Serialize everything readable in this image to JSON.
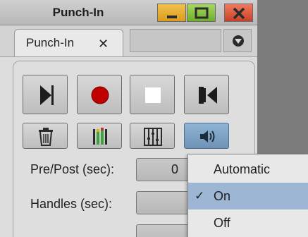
{
  "window": {
    "title": "Punch-In",
    "controls": {
      "minimize": "minimize",
      "maximize": "maximize",
      "close": "close"
    }
  },
  "tab": {
    "label": "Punch-In",
    "close_glyph": "✕"
  },
  "transport": {
    "row1": [
      {
        "name": "play-to-icon"
      },
      {
        "name": "record-icon",
        "color": "#c00000"
      },
      {
        "name": "stop-icon",
        "color": "#ffffff"
      },
      {
        "name": "go-to-punch-in-icon"
      }
    ],
    "row2": [
      {
        "name": "trash-icon"
      },
      {
        "name": "audio-meter-icon"
      },
      {
        "name": "mixer-faders-icon"
      },
      {
        "name": "speaker-icon",
        "active": true
      }
    ]
  },
  "fields": {
    "prepost_label": "Pre/Post (sec):",
    "prepost_value": "0",
    "handles_label": "Handles (sec):",
    "handles_value": ""
  },
  "menu": {
    "items": [
      {
        "label": "Automatic",
        "checked": false
      },
      {
        "label": "On",
        "checked": true
      },
      {
        "label": "Off",
        "checked": false
      }
    ],
    "check_glyph": "✓",
    "selected_color": "#9cb6d3"
  }
}
